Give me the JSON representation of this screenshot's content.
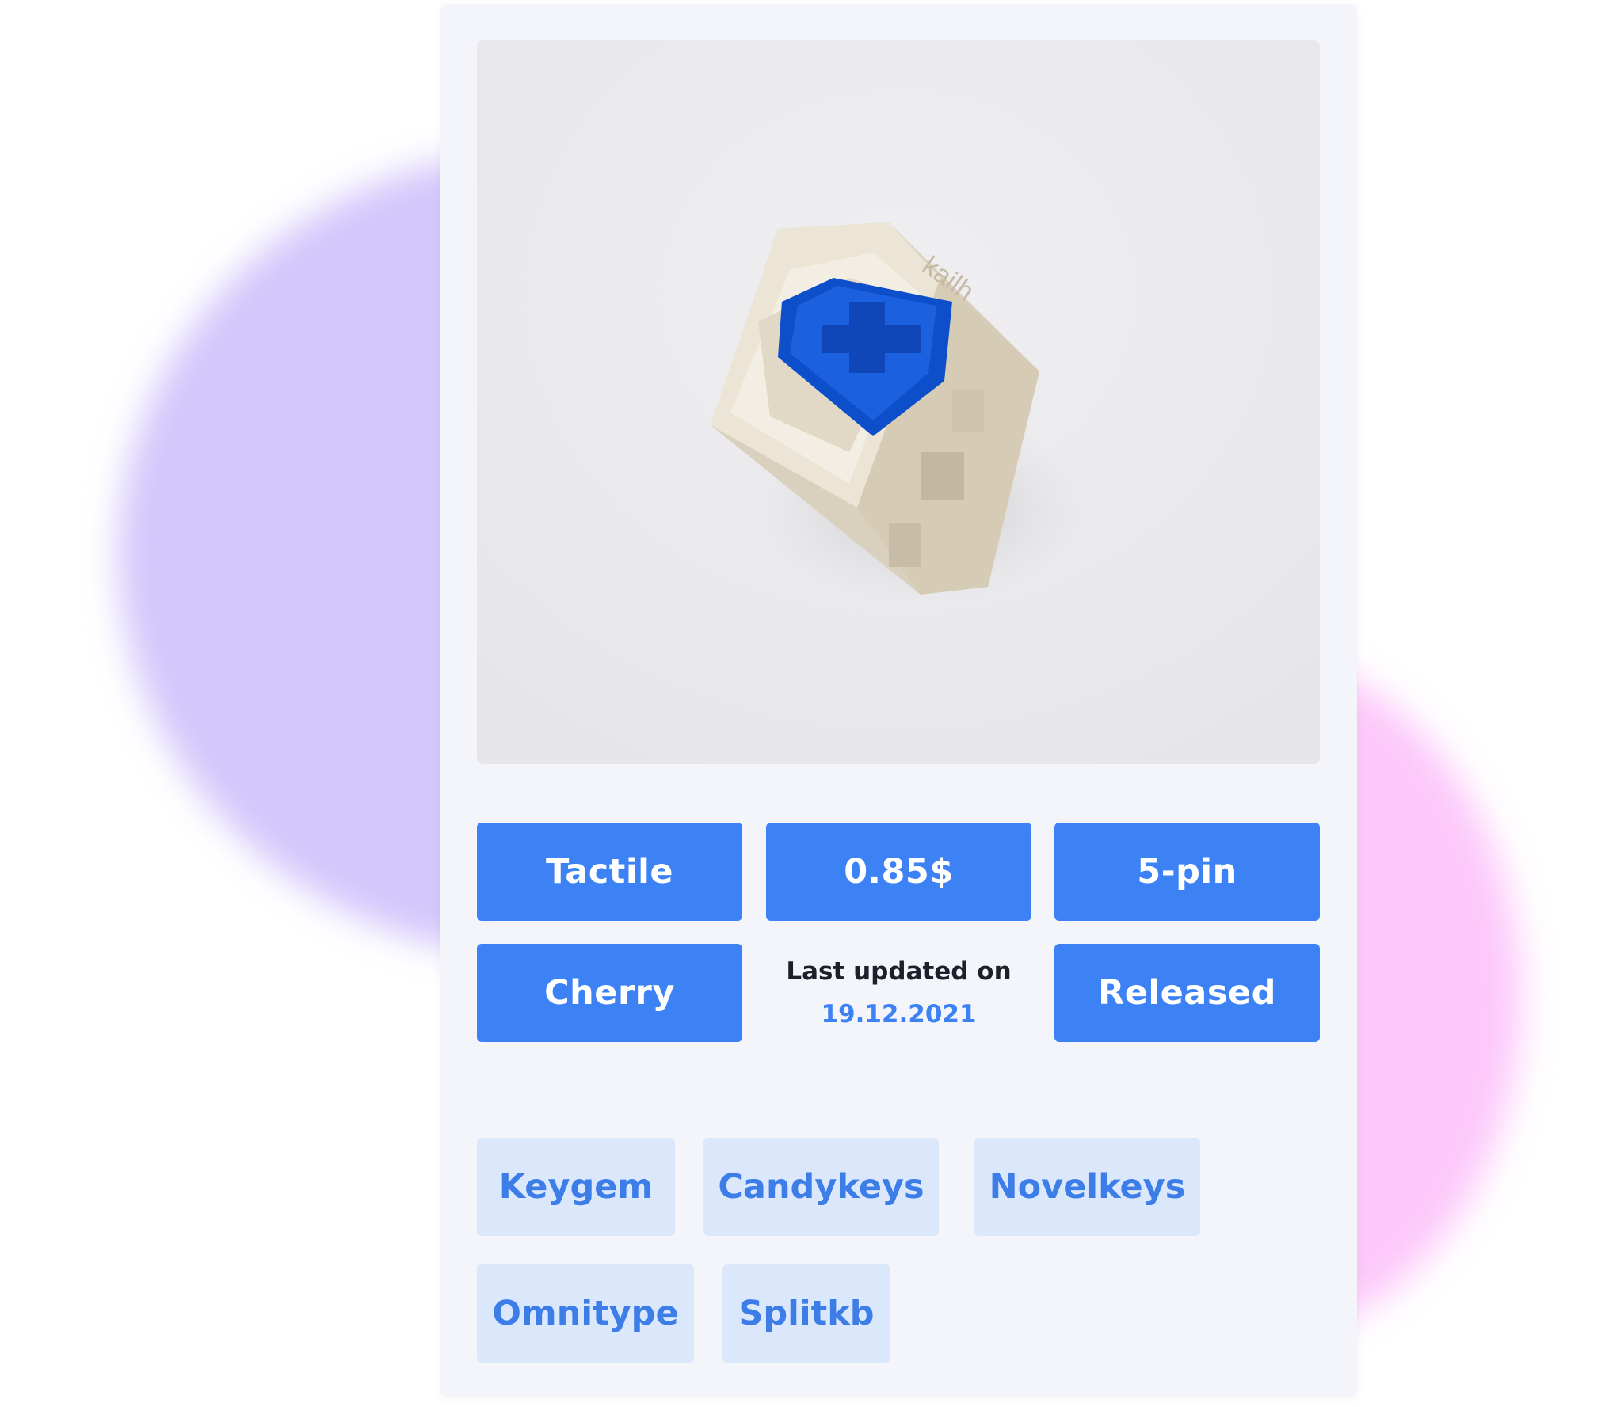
{
  "product": {
    "image_alt": "Kailh mechanical switch with blue stem",
    "switch_brand_mark": "kailh"
  },
  "specs": {
    "type": "Tactile",
    "price": "0.85$",
    "pins": "5-pin",
    "stem": "Cherry",
    "status": "Released"
  },
  "updated": {
    "label": "Last updated on",
    "date": "19.12.2021"
  },
  "vendors": [
    "Keygem",
    "Candykeys",
    "Novelkeys",
    "Omnitype",
    "Splitkb"
  ],
  "colors": {
    "accent": "#3d82f4",
    "tag_bg": "#dbe7fb",
    "card_bg": "#f4f5fa",
    "blob_purple": "#d3c6fb",
    "blob_pink": "#fcc8fa"
  }
}
